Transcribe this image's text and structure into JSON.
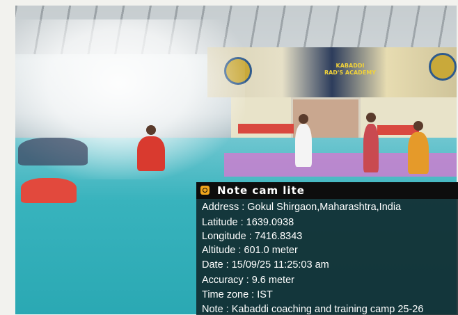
{
  "overlay": {
    "app_name": "Note cam lite",
    "icon": "camera-icon",
    "accent_color": "#f0a51c",
    "lines": [
      "Address : Gokul Shirgaon,Maharashtra,India",
      "Latitude : 1639.0938",
      "Longitude : 7416.8343",
      "Altitude : 601.0 meter",
      "Date : 15/09/25 11:25:03 am",
      "Accuracy : 9.6 meter",
      "Time zone : IST",
      "Note : Kabaddi coaching and training camp 25-26"
    ]
  },
  "scene": {
    "banner_text": [
      "KABADDI",
      "RAD'S ACADEMY"
    ],
    "mat_color": "#2aa8b3",
    "jersey_colors": [
      "#d93a2f",
      "#e59a2a",
      "#2e3a5c"
    ]
  }
}
